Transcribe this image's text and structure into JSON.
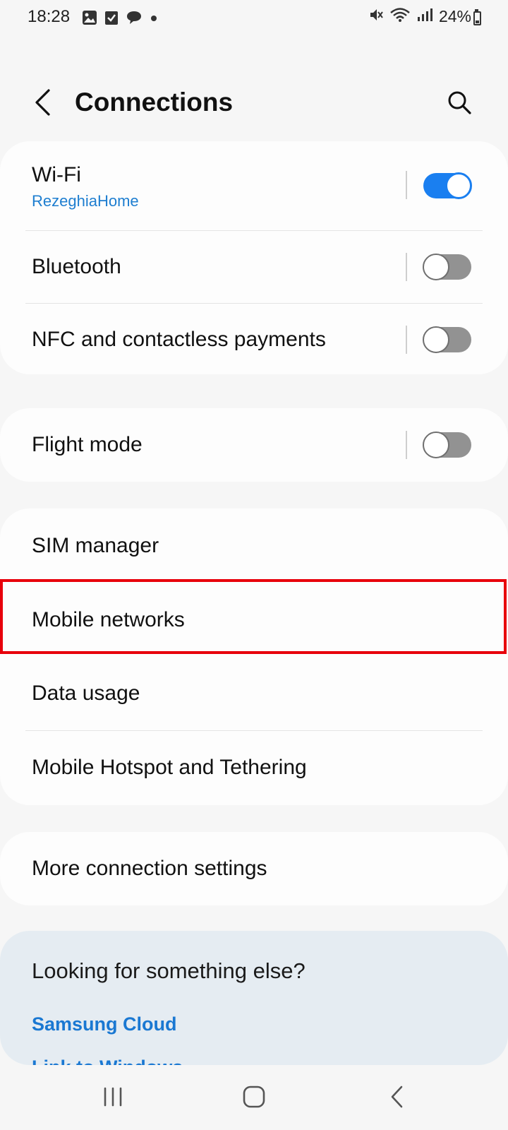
{
  "status_bar": {
    "time": "18:28",
    "battery": "24%",
    "battery_level": 0.24,
    "icons": [
      "gallery-icon",
      "checkbox-icon",
      "chat-icon",
      "dot-icon",
      "mute-icon",
      "wifi-icon",
      "signal-icon",
      "battery-icon"
    ]
  },
  "header": {
    "title": "Connections"
  },
  "groups": {
    "wireless": {
      "wifi": {
        "label": "Wi-Fi",
        "network": "RezeghiaHome",
        "state": "on"
      },
      "bluetooth": {
        "label": "Bluetooth",
        "state": "off"
      },
      "nfc": {
        "label": "NFC and contactless payments",
        "state": "off"
      }
    },
    "flight": {
      "flight_mode": {
        "label": "Flight mode",
        "state": "off"
      }
    },
    "network": {
      "sim_manager": "SIM manager",
      "mobile_networks": "Mobile networks",
      "data_usage": "Data usage",
      "hotspot": "Mobile Hotspot and Tethering"
    },
    "more": {
      "more_settings": "More connection settings"
    }
  },
  "suggestions": {
    "title": "Looking for something else?",
    "links": [
      "Samsung Cloud",
      "Link to Windows"
    ]
  },
  "colors": {
    "accent": "#1a7ff0",
    "link": "#1a78d2",
    "highlight": "#e8000b",
    "card": "#fdfdfd",
    "background": "#f6f6f6",
    "suggestion_card": "#e5ecf2"
  }
}
